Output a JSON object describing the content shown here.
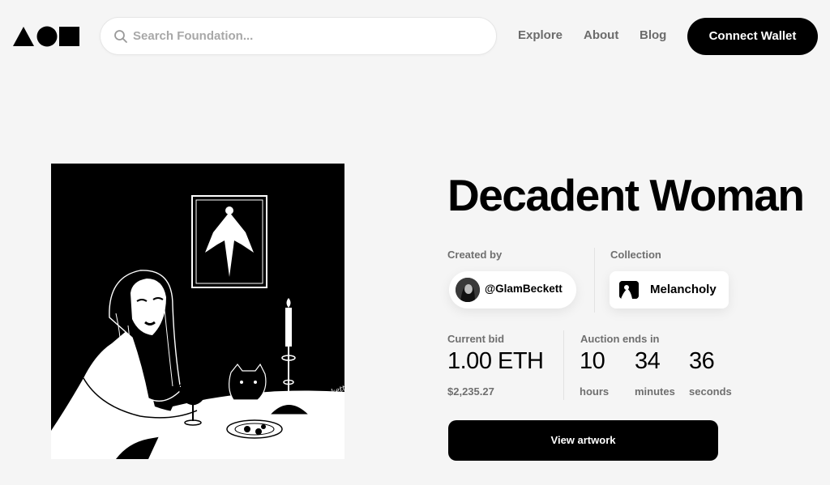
{
  "header": {
    "search": {
      "placeholder": "Search Foundation..."
    },
    "nav": {
      "explore": "Explore",
      "about": "About",
      "blog": "Blog"
    },
    "connect_wallet": "Connect Wallet"
  },
  "artwork": {
    "title": "Decadent Woman",
    "signature": "Glam Beckett",
    "created_by_label": "Created by",
    "creator": "@GlamBeckett",
    "collection_label": "Collection",
    "collection": "Melancholy"
  },
  "auction": {
    "current_bid_label": "Current bid",
    "current_bid": "1.00 ETH",
    "current_bid_usd": "$2,235.27",
    "ends_label": "Auction ends in",
    "hours": "10",
    "hours_label": "hours",
    "minutes": "34",
    "minutes_label": "minutes",
    "seconds": "36",
    "seconds_label": "seconds"
  },
  "view_artwork": "View artwork",
  "colors": {
    "accent": "#000000",
    "background": "#f5f5f5",
    "muted_text": "#6f6f6f"
  }
}
